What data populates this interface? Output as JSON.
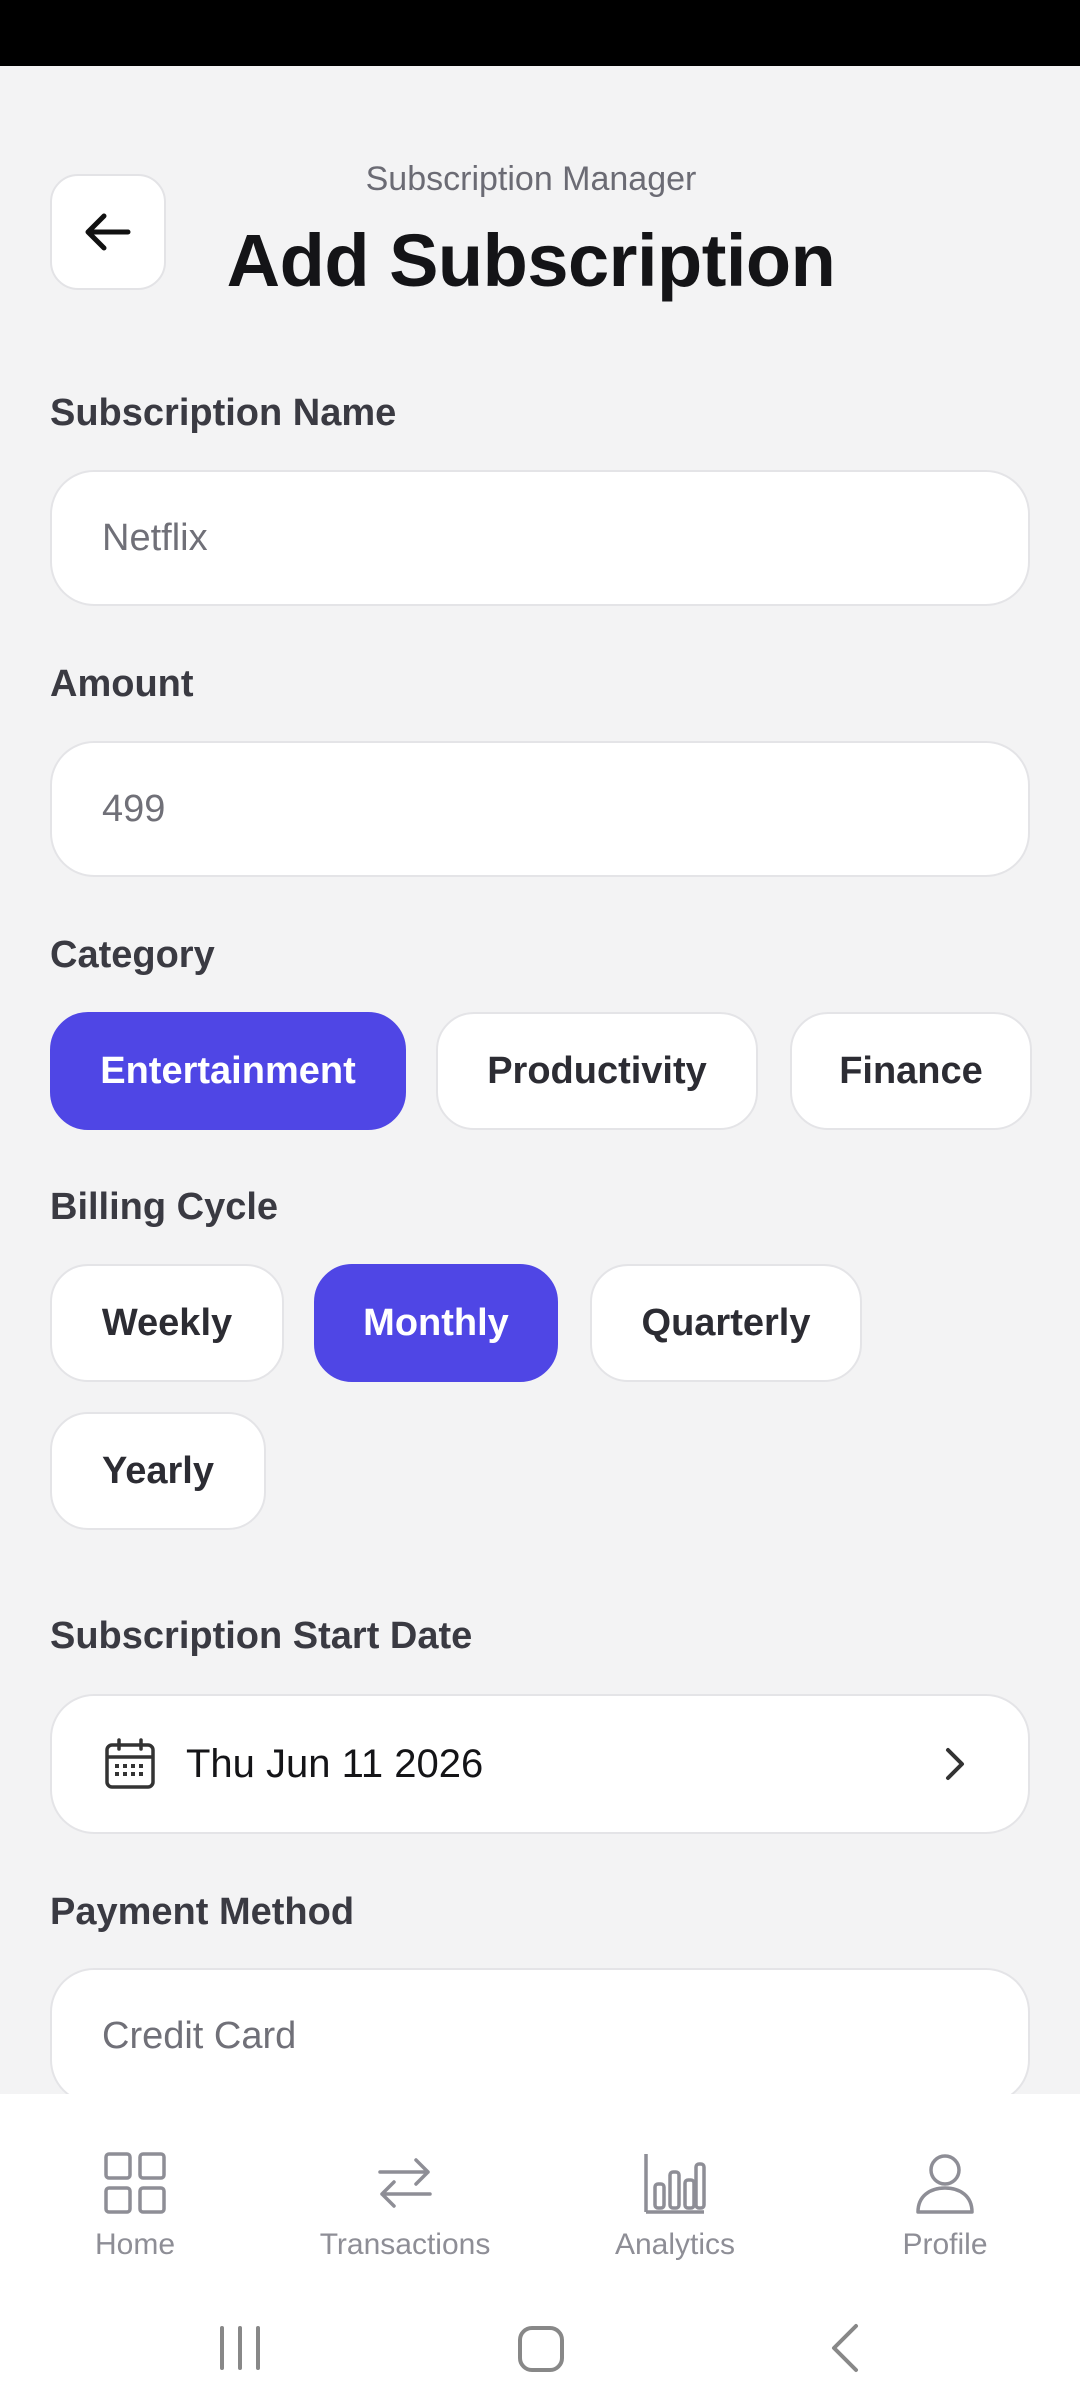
{
  "header": {
    "subtitle": "Subscription Manager",
    "title": "Add Subscription"
  },
  "form": {
    "name": {
      "label": "Subscription Name",
      "placeholder": "Netflix"
    },
    "amount": {
      "label": "Amount",
      "placeholder": "499"
    },
    "category": {
      "label": "Category",
      "options": [
        "Entertainment",
        "Productivity",
        "Finance"
      ],
      "selected": "Entertainment"
    },
    "billing_cycle": {
      "label": "Billing Cycle",
      "options": [
        "Weekly",
        "Monthly",
        "Quarterly",
        "Yearly"
      ],
      "selected": "Monthly"
    },
    "start_date": {
      "label": "Subscription Start Date",
      "value": "Thu Jun 11 2026"
    },
    "payment_method": {
      "label": "Payment Method",
      "placeholder": "Credit Card"
    }
  },
  "bottom_nav": {
    "items": [
      {
        "label": "Home",
        "icon": "grid-icon"
      },
      {
        "label": "Transactions",
        "icon": "swap-arrows-icon"
      },
      {
        "label": "Analytics",
        "icon": "bar-chart-icon"
      },
      {
        "label": "Profile",
        "icon": "person-icon"
      }
    ]
  },
  "colors": {
    "accent": "#4f46e5",
    "background": "#f3f3f4",
    "card": "#ffffff"
  }
}
